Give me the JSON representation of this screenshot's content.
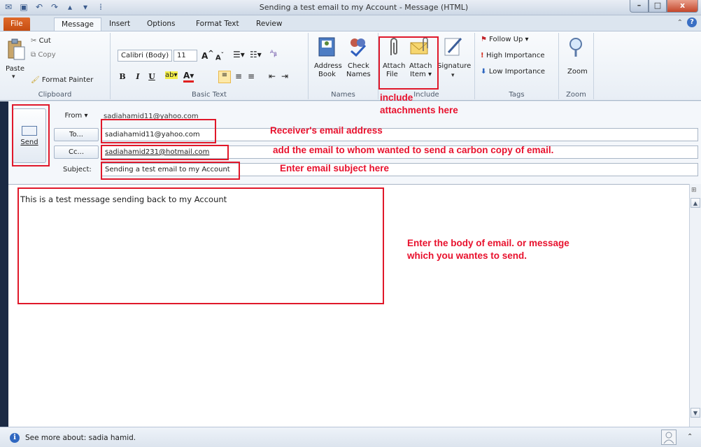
{
  "window": {
    "title": "Sending a test email to my Account  -  Message (HTML)",
    "minimize": "–",
    "maximize": "□",
    "close": "x"
  },
  "tabs": [
    "File",
    "Message",
    "Insert",
    "Options",
    "Format Text",
    "Review"
  ],
  "ribbon": {
    "clipboard": {
      "paste": "Paste",
      "cut": "Cut",
      "copy": "Copy",
      "format_painter": "Format Painter",
      "label": "Clipboard"
    },
    "basic_text": {
      "font_name": "Calibri (Body)",
      "font_size": "11",
      "bold": "B",
      "italic": "I",
      "underline": "U",
      "label": "Basic Text"
    },
    "names": {
      "address_book_1": "Address",
      "address_book_2": "Book",
      "check_names_1": "Check",
      "check_names_2": "Names",
      "label": "Names"
    },
    "include": {
      "attach_file_1": "Attach",
      "attach_file_2": "File",
      "attach_item_1": "Attach",
      "attach_item_2": "Item ▾",
      "signature": "Signature",
      "label": "Include"
    },
    "tags": {
      "follow_up": "Follow Up ▾",
      "high_importance": "High Importance",
      "low_importance": "Low Importance",
      "label": "Tags"
    },
    "zoom": {
      "zoom": "Zoom",
      "label": "Zoom"
    }
  },
  "compose": {
    "send_label": "Send",
    "from_label": "From ▾",
    "from_value": "sadiahamid11@yahoo.com",
    "to_label": "To...",
    "to_value": "sadiahamid11@yahoo.com",
    "cc_label": "Cc...",
    "cc_value": "sadiahamid231@hotmail.com",
    "subject_label": "Subject:",
    "subject_value": "Sending a test email to my Account"
  },
  "body": {
    "text": "This is a test message sending back to my Account"
  },
  "statusbar": {
    "text": "See more about: sadia hamid."
  },
  "annotations": {
    "include_1": "include",
    "include_2": "attachments here",
    "receiver": "Receiver's email address",
    "cc": "add the email to whom wanted to send a carbon copy of email.",
    "subject": "Enter email subject here",
    "body_1": "Enter the body of email. or message",
    "body_2": "which you wantes to send."
  },
  "colors": {
    "annotation": "#e8112d",
    "file_tab": "#d25a1b"
  }
}
